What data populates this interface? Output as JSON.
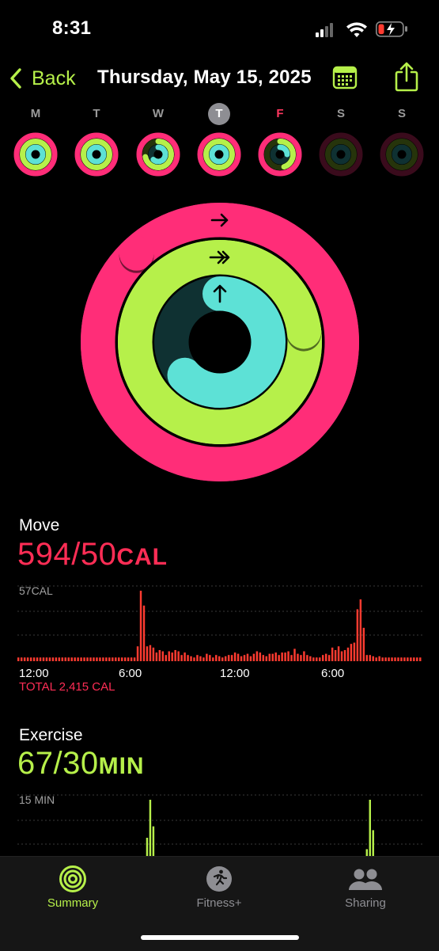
{
  "status": {
    "time": "8:31"
  },
  "nav": {
    "back_label": "Back",
    "title": "Thursday, May 15, 2025"
  },
  "week": [
    {
      "label": "M",
      "move": 1.0,
      "exercise": 1.0,
      "stand": 1.0,
      "state": "normal"
    },
    {
      "label": "T",
      "move": 1.0,
      "exercise": 1.0,
      "stand": 1.0,
      "state": "normal"
    },
    {
      "label": "W",
      "move": 1.0,
      "exercise": 0.72,
      "stand": 0.62,
      "state": "normal"
    },
    {
      "label": "T",
      "move": 1.0,
      "exercise": 1.0,
      "stand": 1.0,
      "state": "today"
    },
    {
      "label": "F",
      "move": 1.0,
      "exercise": 0.45,
      "stand": 0.25,
      "state": "red"
    },
    {
      "label": "S",
      "move": 0,
      "exercise": 0,
      "stand": 0,
      "state": "normal"
    },
    {
      "label": "S",
      "move": 0,
      "exercise": 0,
      "stand": 0,
      "state": "normal"
    }
  ],
  "rings": {
    "move_progress": 11.88,
    "exercise_progress": 2.23,
    "stand_progress": 0.63
  },
  "colors": {
    "move": "#ff2d78",
    "exercise": "#b6f04a",
    "stand": "#5de1d6",
    "accent_text_move": "#ff2d55"
  },
  "move": {
    "title": "Move",
    "value": "594/50",
    "unit": "CAL",
    "chart_max_label": "57CAL",
    "ticks": [
      "12:00",
      "6:00",
      "12:00",
      "6:00"
    ],
    "total": "TOTAL 2,415 CAL"
  },
  "exercise": {
    "title": "Exercise",
    "value": "67/30",
    "unit": "MIN",
    "chart_max_label": "15 MIN"
  },
  "chart_data": [
    {
      "type": "bar",
      "title": "Move",
      "ylabel": "57CAL",
      "x_ticks": [
        "12:00",
        "6:00",
        "12:00",
        "6:00"
      ],
      "ylim": [
        0,
        57
      ],
      "values": [
        3,
        3,
        3,
        3,
        3,
        3,
        3,
        3,
        3,
        3,
        3,
        3,
        3,
        3,
        3,
        3,
        3,
        3,
        3,
        3,
        3,
        3,
        3,
        3,
        3,
        3,
        3,
        3,
        3,
        3,
        3,
        3,
        3,
        3,
        3,
        3,
        3,
        3,
        12,
        57,
        45,
        12,
        13,
        11,
        7,
        9,
        8,
        5,
        8,
        7,
        9,
        8,
        5,
        7,
        5,
        4,
        3,
        5,
        4,
        3,
        6,
        5,
        3,
        5,
        4,
        3,
        4,
        5,
        5,
        7,
        6,
        4,
        5,
        6,
        4,
        6,
        8,
        7,
        5,
        4,
        6,
        6,
        7,
        5,
        7,
        7,
        8,
        5,
        10,
        6,
        5,
        8,
        5,
        4,
        3,
        3,
        3,
        5,
        6,
        5,
        11,
        9,
        12,
        8,
        9,
        11,
        14,
        15,
        42,
        50,
        27,
        5,
        5,
        4,
        3,
        4,
        3,
        3,
        3,
        3,
        3,
        3,
        3,
        3,
        3,
        3,
        3,
        3,
        3
      ]
    },
    {
      "type": "bar",
      "title": "Exercise",
      "ylabel": "15 MIN",
      "ylim": [
        0,
        15
      ],
      "values": [
        0,
        0,
        0,
        0,
        0,
        0,
        0,
        0,
        0,
        0,
        0,
        0,
        0,
        0,
        0,
        0,
        0,
        0,
        0,
        0,
        0,
        0,
        0,
        0,
        0,
        0,
        0,
        0,
        0,
        0,
        0,
        0,
        0,
        0,
        0,
        0,
        0,
        0,
        0,
        0,
        0,
        5,
        15,
        8,
        0,
        0,
        0,
        0,
        0,
        0,
        0,
        0,
        0,
        0,
        0,
        0,
        0,
        0,
        0,
        0,
        0,
        0,
        0,
        0,
        0,
        0,
        0,
        0,
        0,
        0,
        0,
        0,
        0,
        0,
        0,
        0,
        0,
        0,
        0,
        0,
        0,
        0,
        0,
        0,
        0,
        0,
        0,
        0,
        0,
        0,
        0,
        0,
        0,
        0,
        0,
        0,
        0,
        0,
        0,
        0,
        0,
        0,
        0,
        0,
        0,
        0,
        0,
        0,
        0,
        0,
        0,
        2,
        15,
        7,
        0,
        0,
        0,
        0,
        0,
        0,
        0,
        0,
        0,
        0,
        0,
        0,
        0,
        0,
        0
      ]
    }
  ],
  "tabs": [
    {
      "label": "Summary",
      "icon": "summary-rings-icon",
      "active": true
    },
    {
      "label": "Fitness+",
      "icon": "runner-icon",
      "active": false
    },
    {
      "label": "Sharing",
      "icon": "people-icon",
      "active": false
    }
  ]
}
